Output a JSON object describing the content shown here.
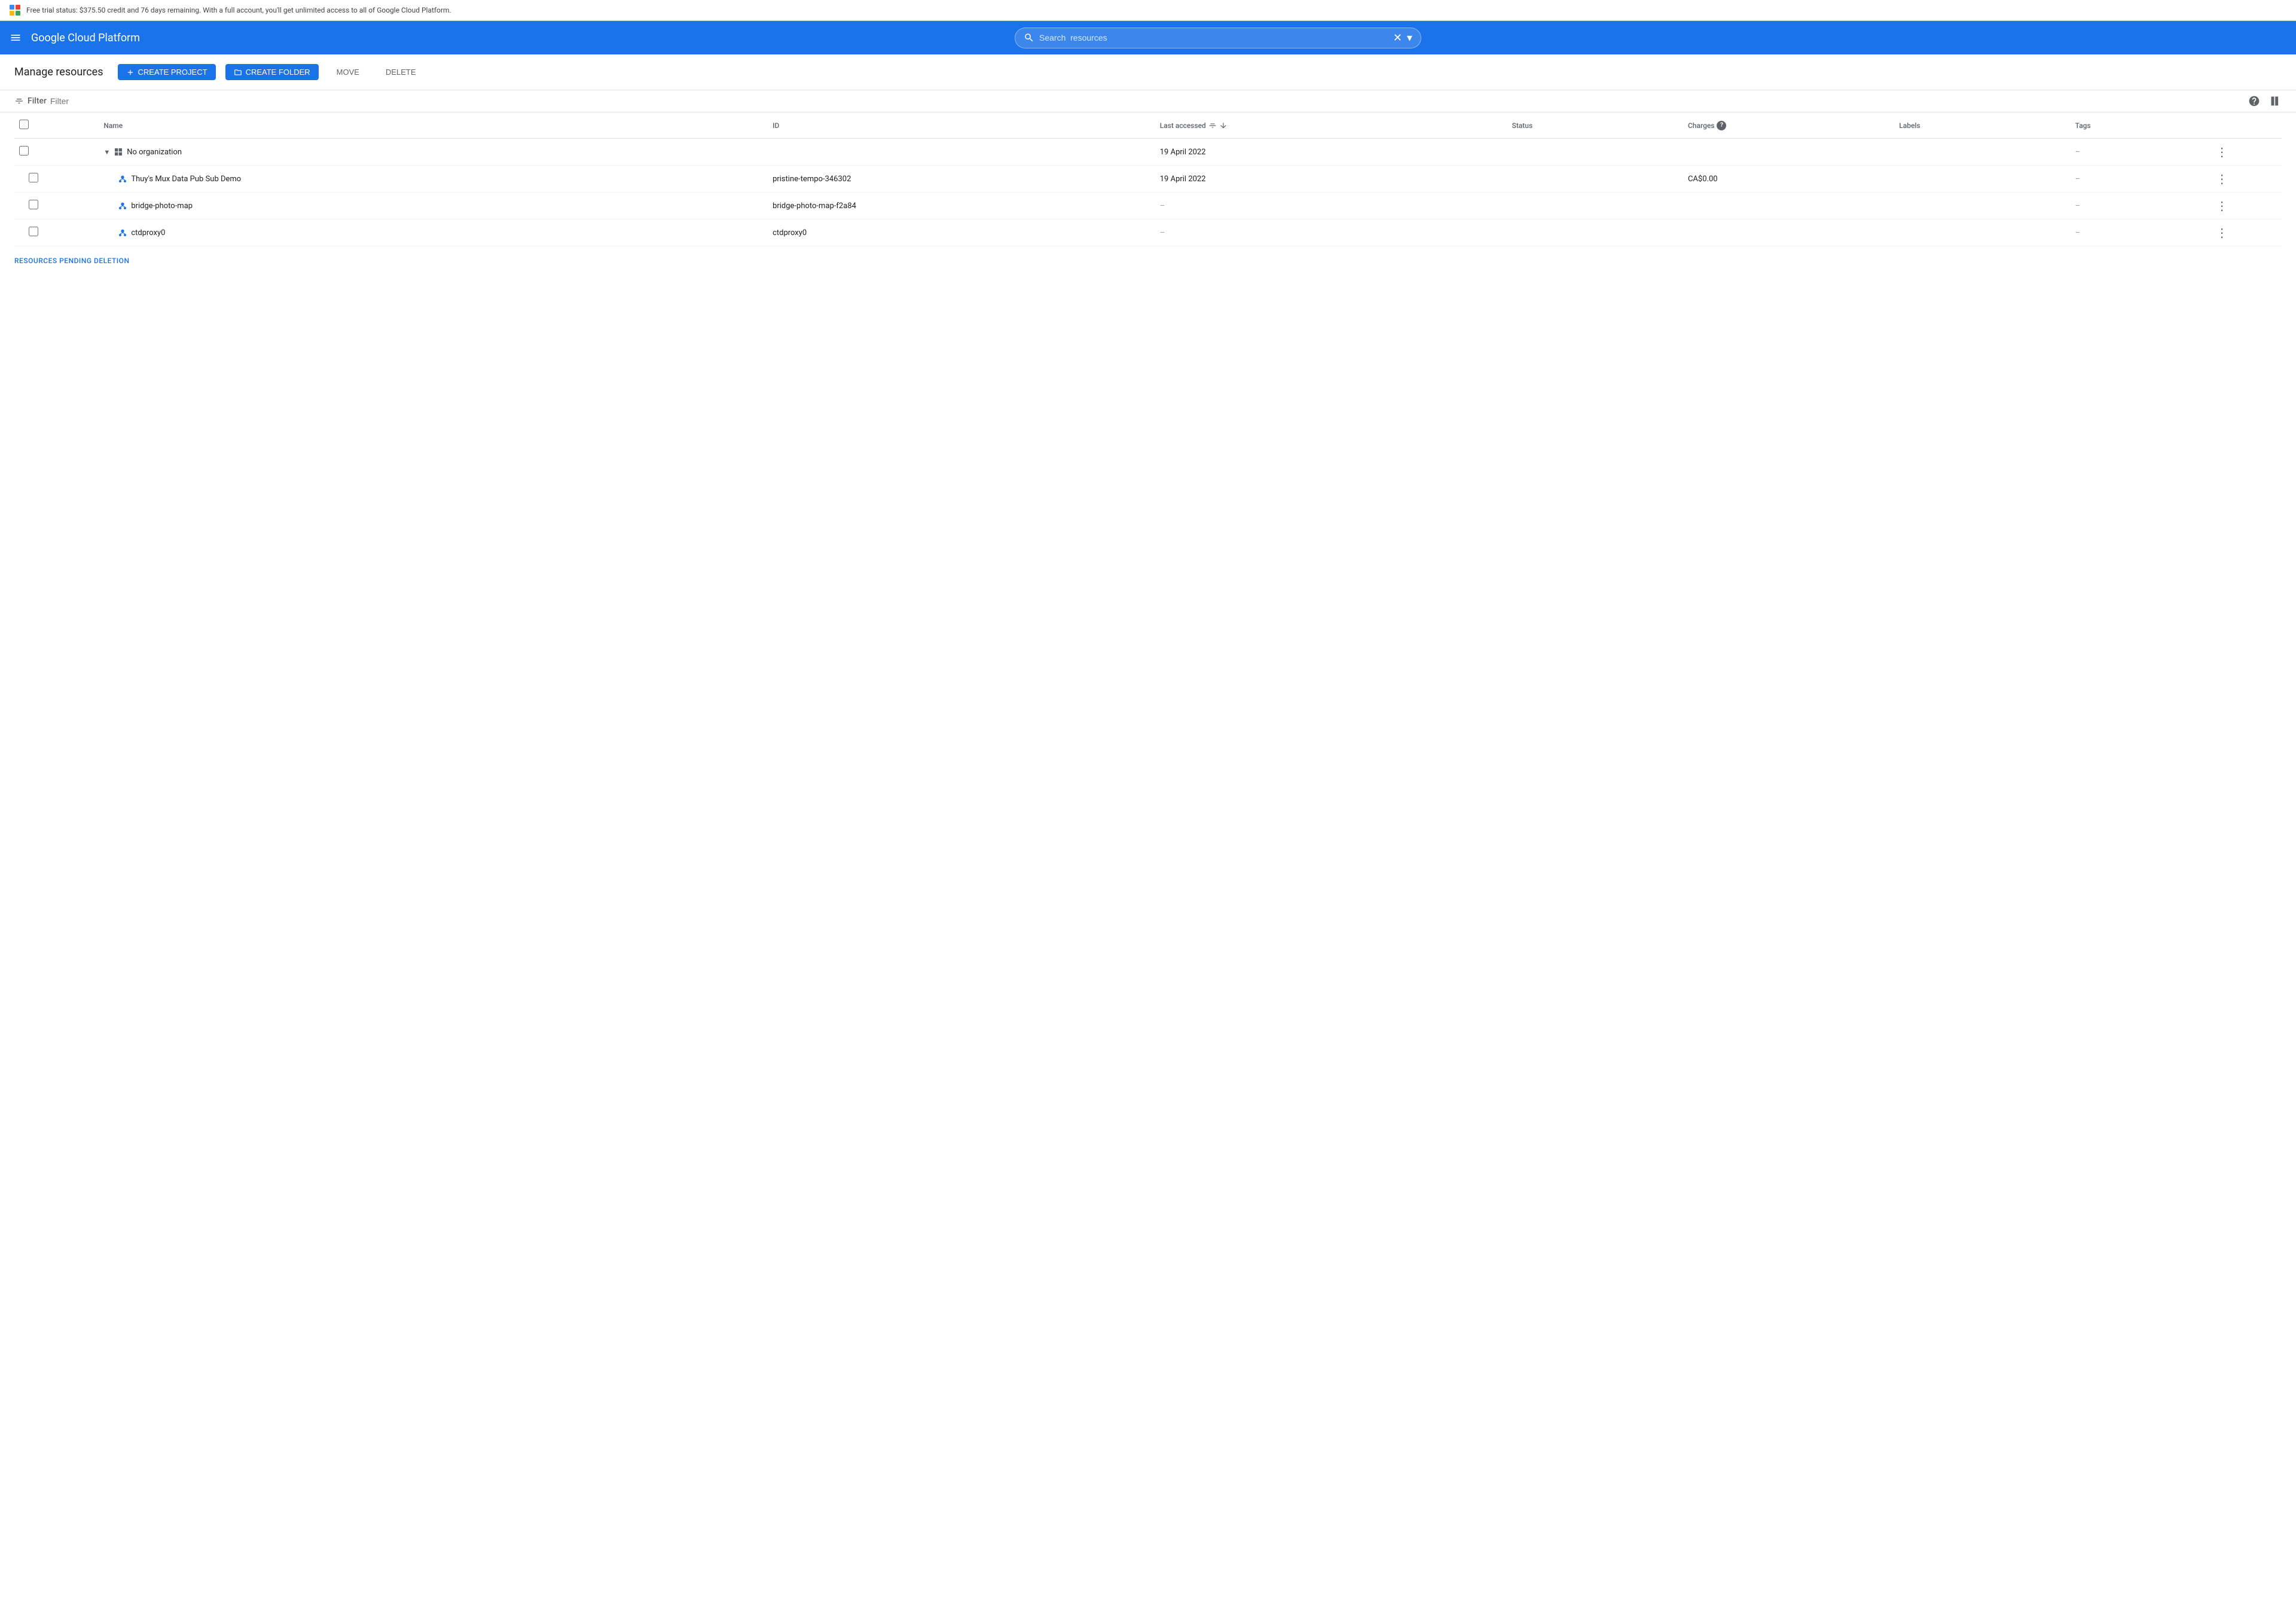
{
  "trial_banner": {
    "text": "Free trial status: $375.50 credit and 76 days remaining. With a full account, you'll get unlimited access to all of Google Cloud Platform."
  },
  "navbar": {
    "title": "Google Cloud Platform",
    "search_placeholder": "Search  resources",
    "clear_label": "×",
    "expand_label": "▾"
  },
  "page": {
    "title": "Manage resources",
    "buttons": {
      "create_project": "CREATE PROJECT",
      "create_folder": "CREATE FOLDER",
      "move": "MOVE",
      "delete": "DELETE"
    }
  },
  "filter": {
    "label": "Filter",
    "placeholder": "Filter"
  },
  "table": {
    "columns": {
      "name": "Name",
      "id": "ID",
      "last_accessed": "Last accessed",
      "status": "Status",
      "charges": "Charges",
      "labels": "Labels",
      "tags": "Tags"
    },
    "rows": [
      {
        "type": "org",
        "name": "No organization",
        "id": "",
        "last_accessed": "19 April 2022",
        "status": "",
        "charges": "",
        "labels": "",
        "tags": "–"
      },
      {
        "type": "project",
        "name": "Thuy's Mux Data Pub Sub Demo",
        "id": "pristine-tempo-346302",
        "last_accessed": "19 April 2022",
        "status": "",
        "charges": "CA$0.00",
        "labels": "",
        "tags": "–"
      },
      {
        "type": "project",
        "name": "bridge-photo-map",
        "id": "bridge-photo-map-f2a84",
        "last_accessed": "–",
        "status": "",
        "charges": "",
        "labels": "",
        "tags": "–"
      },
      {
        "type": "project",
        "name": "ctdproxy0",
        "id": "ctdproxy0",
        "last_accessed": "–",
        "status": "",
        "charges": "",
        "labels": "",
        "tags": "–"
      }
    ]
  },
  "pending_deletion": {
    "label": "RESOURCES PENDING DELETION"
  }
}
